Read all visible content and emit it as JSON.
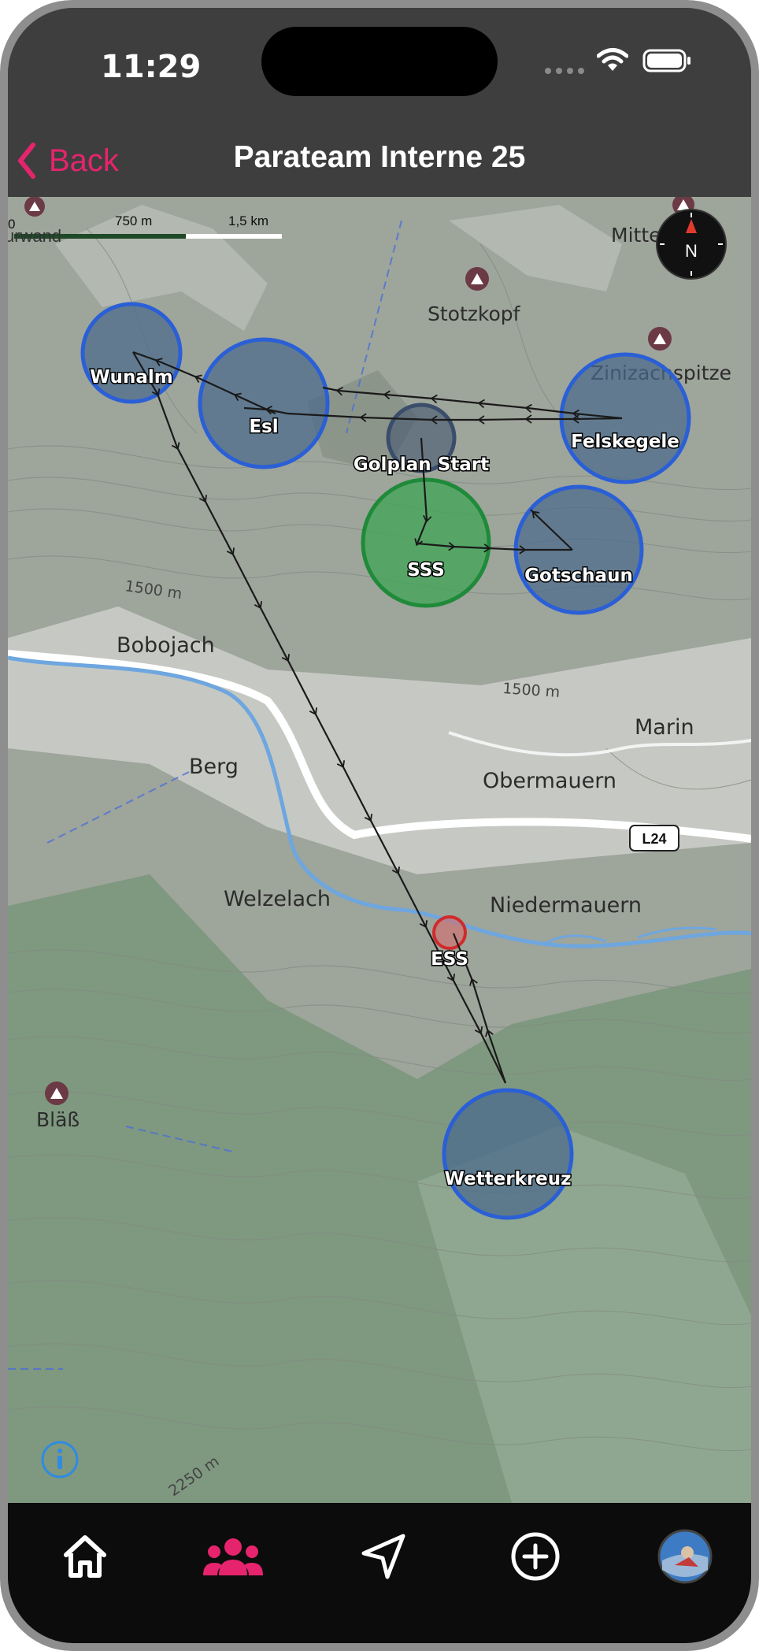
{
  "status_bar": {
    "time": "11:29"
  },
  "nav": {
    "back_label": "Back",
    "title": "Parateam Interne 25"
  },
  "scale_bar": {
    "labels": [
      "0",
      "750 m",
      "1,5 km"
    ]
  },
  "compass": {
    "label": "N"
  },
  "map_labels": {
    "stotzkopf": "Stotzkopf",
    "zinizachspitze": "Zinizachspitze",
    "mitter": "Mitter",
    "bobojach": "Bobojach",
    "berg": "Berg",
    "marin": "Marin",
    "obermauern": "Obermauern",
    "welzelach": "Welzelach",
    "niedermauern": "Niedermauern",
    "blass": "Bläß",
    "road": "L24",
    "contour_1500_a": "1500 m",
    "contour_1500_b": "1500 m",
    "contour_2250": "2250 m",
    "partial_top_left": "urwand"
  },
  "turnpoints": {
    "wunalm": "Wunalm",
    "esl": "Esl",
    "golplan": "Golplan Start",
    "felskegele": "Felskegele",
    "sss": "SSS",
    "gotschaun": "Gotschaun",
    "ess": "ESS",
    "wetterkreuz": "Wetterkreuz"
  },
  "colors": {
    "accent": "#e6246d",
    "turnpoint_fill": "#4a6d8f",
    "turnpoint_stroke": "#2a5fd6",
    "sss_fill": "#3fa356",
    "sss_stroke": "#1f8a3a",
    "ess_stroke": "#d02a2a"
  },
  "tabs": [
    "home",
    "teams",
    "navigate",
    "add",
    "profile"
  ],
  "icons": [
    "chevron-left-icon",
    "compass-icon",
    "info-icon",
    "home-icon",
    "people-icon",
    "navigation-icon",
    "add-circle-icon",
    "avatar"
  ]
}
